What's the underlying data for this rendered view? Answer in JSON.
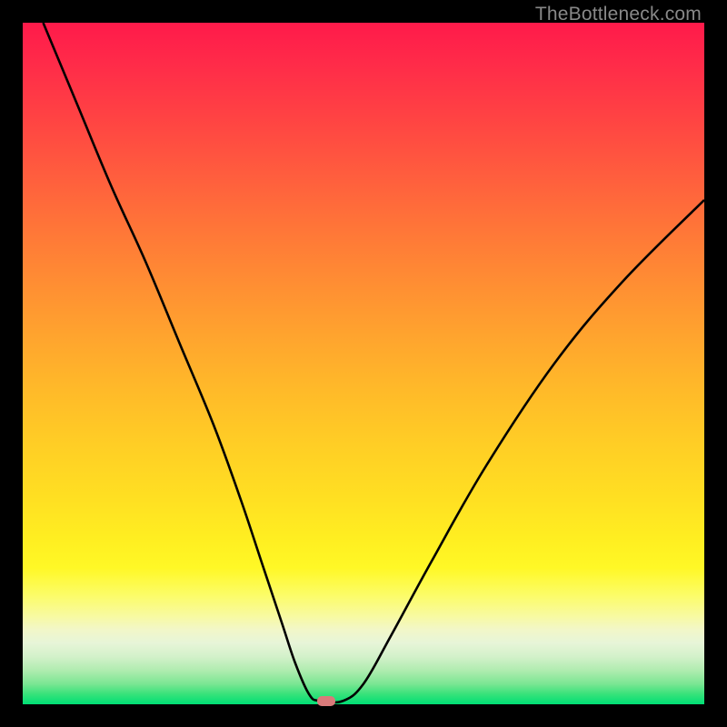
{
  "watermark": "TheBottleneck.com",
  "chart_data": {
    "type": "line",
    "title": "",
    "xlabel": "",
    "ylabel": "",
    "xlim": [
      0,
      100
    ],
    "ylim": [
      0,
      100
    ],
    "grid": false,
    "series": [
      {
        "name": "curve",
        "x": [
          3,
          8,
          13,
          18,
          23,
          28,
          32,
          35,
          38,
          40,
          42,
          43.5,
          47,
          50,
          54,
          60,
          68,
          78,
          88,
          100
        ],
        "y": [
          100,
          88,
          76,
          65,
          53,
          41,
          30,
          21,
          12,
          6,
          1.5,
          0.5,
          0.5,
          3,
          10,
          21,
          35,
          50,
          62,
          74
        ]
      }
    ],
    "marker": {
      "x": 44.5,
      "y": 0.5,
      "color": "#d97a7a"
    },
    "background_gradient": {
      "top": "#ff1a4a",
      "mid": "#ffe022",
      "bottom": "#00df75"
    }
  }
}
